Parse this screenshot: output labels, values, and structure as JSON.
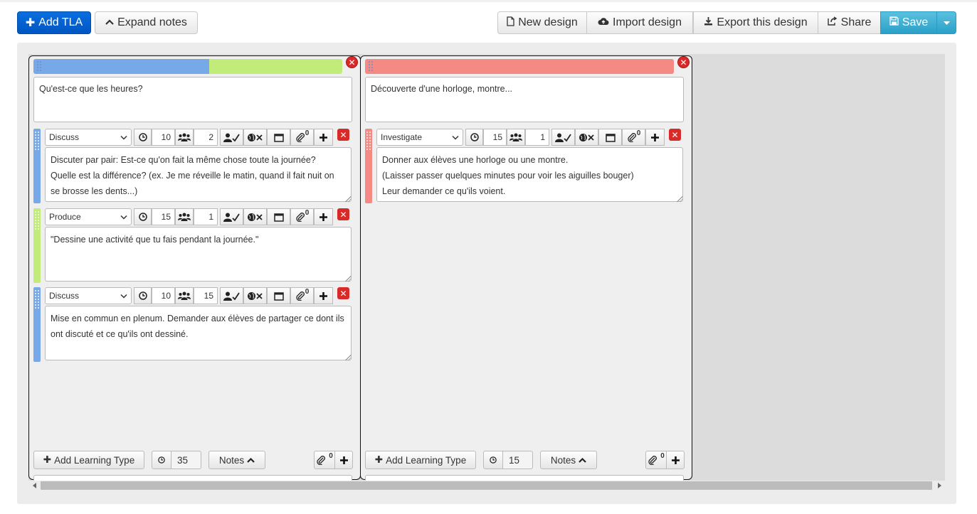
{
  "toolbar": {
    "add_tla": "Add TLA",
    "expand_notes": "Expand notes",
    "new_design": "New design",
    "import_design": "Import design",
    "export_design": "Export this design",
    "share": "Share",
    "save": "Save"
  },
  "colors": {
    "discuss": "#77a9e8",
    "produce": "#c1ec7a",
    "investigate": "#f58a85",
    "primary": "#005bd3",
    "save": "#3aaed6"
  },
  "tlas": [
    {
      "header_segments": [
        {
          "type": "discuss",
          "fraction": 0.57
        },
        {
          "type": "produce",
          "fraction": 0.43
        }
      ],
      "description": "Qu'est-ce que les heures?",
      "activities": [
        {
          "type": "Discuss",
          "color": "discuss",
          "duration": "10",
          "group_size": "2",
          "attachments": "0",
          "text": "Discuter par pair: Est-ce qu'on fait la même chose toute la journée?\nQuelle est la différence?  (ex. Je me réveille le matin, quand il fait nuit on se brosse les dents...)"
        },
        {
          "type": "Produce",
          "color": "produce",
          "duration": "15",
          "group_size": "1",
          "attachments": "0",
          "text": "\"Dessine une activité que tu fais pendant la journée.\""
        },
        {
          "type": "Discuss",
          "color": "discuss",
          "duration": "10",
          "group_size": "15",
          "attachments": "0",
          "text": "Mise en commun en plenum. Demander aux élèves de partager ce dont ils ont discuté et ce qu'ils ont dessiné."
        }
      ],
      "add_learning_type": "Add Learning Type",
      "total_time": "35",
      "notes_label": "Notes",
      "attachments": "0"
    },
    {
      "header_segments": [
        {
          "type": "investigate",
          "fraction": 1.0
        }
      ],
      "description": "Découverte d'une horloge, montre...",
      "activities": [
        {
          "type": "Investigate",
          "color": "investigate",
          "duration": "15",
          "group_size": "1",
          "attachments": "0",
          "text": "Donner aux élèves une horloge ou une montre.\n(Laisser passer quelques minutes pour voir les aiguilles bouger)\nLeur demander ce qu'ils voient."
        }
      ],
      "add_learning_type": "Add Learning Type",
      "total_time": "15",
      "notes_label": "Notes",
      "attachments": "0"
    }
  ]
}
